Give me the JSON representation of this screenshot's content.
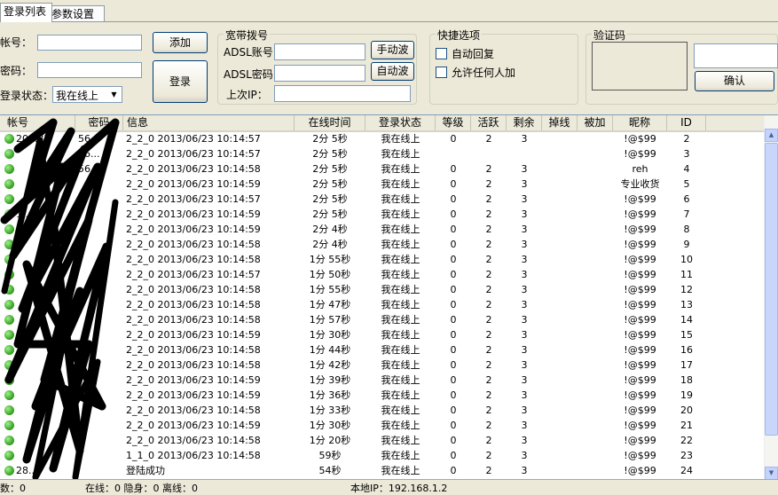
{
  "tabs": [
    "登录列表",
    "参数设置"
  ],
  "login": {
    "account_label": "帐号：",
    "password_label": "密码：",
    "state_label": "登录状态：",
    "state_value": "我在线上",
    "add_button": "添加",
    "login_button": "登录"
  },
  "adsl": {
    "group_title": "宽带拨号",
    "account_label": "ADSL账号",
    "password_label": "ADSL密码",
    "last_ip_label": "上次IP：",
    "manual_dial_button": "手动波",
    "auto_dial_button": "自动波"
  },
  "quick": {
    "group_title": "快捷选项",
    "auto_reply": "自动回复",
    "allow_anyone": "允许任何人加"
  },
  "captcha": {
    "group_title": "验证码",
    "confirm_button": "确认"
  },
  "table": {
    "headers": [
      "帐号",
      "密码",
      "信息",
      "在线时间",
      "登录状态",
      "等级",
      "活跃",
      "剩余",
      "掉线",
      "被加",
      "昵称",
      "ID"
    ],
    "rows": [
      {
        "account": "20...37",
        "password": "56...",
        "info": "2_2_0 2013/06/23 10:14:57",
        "online": "2分 5秒",
        "state": "我在线上",
        "level": "0",
        "active": "2",
        "remain": "3",
        "drop": "",
        "added": "",
        "nick": "!@$99",
        "id": "2"
      },
      {
        "account": "",
        "password": "56...",
        "info": "2_2_0 2013/06/23 10:14:57",
        "online": "2分 5秒",
        "state": "我在线上",
        "level": "",
        "active": "",
        "remain": "",
        "drop": "",
        "added": "",
        "nick": "!@$99",
        "id": "3"
      },
      {
        "account": "",
        "password": "56...",
        "info": "2_2_0 2013/06/23 10:14:58",
        "online": "2分 5秒",
        "state": "我在线上",
        "level": "0",
        "active": "2",
        "remain": "3",
        "drop": "",
        "added": "",
        "nick": "reh",
        "id": "4"
      },
      {
        "account": "",
        "password": "",
        "info": "2_2_0 2013/06/23 10:14:59",
        "online": "2分 5秒",
        "state": "我在线上",
        "level": "0",
        "active": "2",
        "remain": "3",
        "drop": "",
        "added": "",
        "nick": "专业收货",
        "id": "5"
      },
      {
        "account": "",
        "password": "",
        "info": "2_2_0 2013/06/23 10:14:57",
        "online": "2分 5秒",
        "state": "我在线上",
        "level": "0",
        "active": "2",
        "remain": "3",
        "drop": "",
        "added": "",
        "nick": "!@$99",
        "id": "6"
      },
      {
        "account": "1...15",
        "password": "",
        "info": "2_2_0 2013/06/23 10:14:59",
        "online": "2分 5秒",
        "state": "我在线上",
        "level": "0",
        "active": "2",
        "remain": "3",
        "drop": "",
        "added": "",
        "nick": "!@$99",
        "id": "7"
      },
      {
        "account": "",
        "password": "",
        "info": "2_2_0 2013/06/23 10:14:59",
        "online": "2分 4秒",
        "state": "我在线上",
        "level": "0",
        "active": "2",
        "remain": "3",
        "drop": "",
        "added": "",
        "nick": "!@$99",
        "id": "8"
      },
      {
        "account": "",
        "password": "",
        "info": "2_2_0 2013/06/23 10:14:58",
        "online": "2分 4秒",
        "state": "我在线上",
        "level": "0",
        "active": "2",
        "remain": "3",
        "drop": "",
        "added": "",
        "nick": "!@$99",
        "id": "9"
      },
      {
        "account": "",
        "password": "",
        "info": "2_2_0 2013/06/23 10:14:58",
        "online": "1分 55秒",
        "state": "我在线上",
        "level": "0",
        "active": "2",
        "remain": "3",
        "drop": "",
        "added": "",
        "nick": "!@$99",
        "id": "10"
      },
      {
        "account": "",
        "password": "",
        "info": "2_2_0 2013/06/23 10:14:57",
        "online": "1分 50秒",
        "state": "我在线上",
        "level": "0",
        "active": "2",
        "remain": "3",
        "drop": "",
        "added": "",
        "nick": "!@$99",
        "id": "11"
      },
      {
        "account": "",
        "password": "",
        "info": "2_2_0 2013/06/23 10:14:58",
        "online": "1分 55秒",
        "state": "我在线上",
        "level": "0",
        "active": "2",
        "remain": "3",
        "drop": "",
        "added": "",
        "nick": "!@$99",
        "id": "12"
      },
      {
        "account": "",
        "password": "",
        "info": "2_2_0 2013/06/23 10:14:58",
        "online": "1分 47秒",
        "state": "我在线上",
        "level": "0",
        "active": "2",
        "remain": "3",
        "drop": "",
        "added": "",
        "nick": "!@$99",
        "id": "13"
      },
      {
        "account": "",
        "password": "",
        "info": "2_2_0 2013/06/23 10:14:58",
        "online": "1分 57秒",
        "state": "我在线上",
        "level": "0",
        "active": "2",
        "remain": "3",
        "drop": "",
        "added": "",
        "nick": "!@$99",
        "id": "14"
      },
      {
        "account": "",
        "password": "",
        "info": "2_2_0 2013/06/23 10:14:59",
        "online": "1分 30秒",
        "state": "我在线上",
        "level": "0",
        "active": "2",
        "remain": "3",
        "drop": "",
        "added": "",
        "nick": "!@$99",
        "id": "15"
      },
      {
        "account": "",
        "password": "",
        "info": "2_2_0 2013/06/23 10:14:58",
        "online": "1分 44秒",
        "state": "我在线上",
        "level": "0",
        "active": "2",
        "remain": "3",
        "drop": "",
        "added": "",
        "nick": "!@$99",
        "id": "16"
      },
      {
        "account": "",
        "password": "",
        "info": "2_2_0 2013/06/23 10:14:58",
        "online": "1分 42秒",
        "state": "我在线上",
        "level": "0",
        "active": "2",
        "remain": "3",
        "drop": "",
        "added": "",
        "nick": "!@$99",
        "id": "17"
      },
      {
        "account": "",
        "password": "",
        "info": "2_2_0 2013/06/23 10:14:59",
        "online": "1分 39秒",
        "state": "我在线上",
        "level": "0",
        "active": "2",
        "remain": "3",
        "drop": "",
        "added": "",
        "nick": "!@$99",
        "id": "18"
      },
      {
        "account": "",
        "password": "",
        "info": "2_2_0 2013/06/23 10:14:59",
        "online": "1分 36秒",
        "state": "我在线上",
        "level": "0",
        "active": "2",
        "remain": "3",
        "drop": "",
        "added": "",
        "nick": "!@$99",
        "id": "19"
      },
      {
        "account": "",
        "password": "",
        "info": "2_2_0 2013/06/23 10:14:58",
        "online": "1分 33秒",
        "state": "我在线上",
        "level": "0",
        "active": "2",
        "remain": "3",
        "drop": "",
        "added": "",
        "nick": "!@$99",
        "id": "20"
      },
      {
        "account": "",
        "password": "",
        "info": "2_2_0 2013/06/23 10:14:59",
        "online": "1分 30秒",
        "state": "我在线上",
        "level": "0",
        "active": "2",
        "remain": "3",
        "drop": "",
        "added": "",
        "nick": "!@$99",
        "id": "21"
      },
      {
        "account": "",
        "password": "",
        "info": "2_2_0 2013/06/23 10:14:58",
        "online": "1分 20秒",
        "state": "我在线上",
        "level": "0",
        "active": "2",
        "remain": "3",
        "drop": "",
        "added": "",
        "nick": "!@$99",
        "id": "22"
      },
      {
        "account": "",
        "password": "",
        "info": "1_1_0 2013/06/23 10:14:58",
        "online": "59秒",
        "state": "我在线上",
        "level": "0",
        "active": "2",
        "remain": "3",
        "drop": "",
        "added": "",
        "nick": "!@$99",
        "id": "23"
      },
      {
        "account": "28...",
        "password": "",
        "info": "登陆成功",
        "online": "54秒",
        "state": "我在线上",
        "level": "0",
        "active": "2",
        "remain": "3",
        "drop": "",
        "added": "",
        "nick": "!@$99",
        "id": "24"
      }
    ]
  },
  "statusbar": {
    "count": "数：0",
    "online": "在线：0 隐身：0 离线：0",
    "local_ip": "本地IP：192.168.1.2"
  }
}
